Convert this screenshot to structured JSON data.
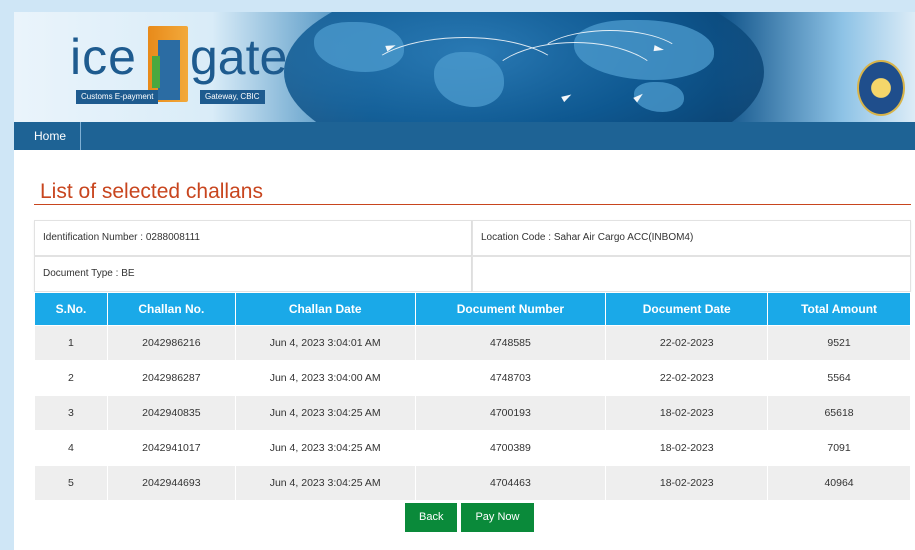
{
  "logo": {
    "ice": "ice",
    "gate": "gate",
    "sub_left": "Customs E-payment",
    "sub_right": "Gateway, CBIC"
  },
  "nav": {
    "home": "Home"
  },
  "page_title": "List of selected challans",
  "info": {
    "identification": "Identification Number : 0288008111",
    "location": "Location Code : Sahar Air Cargo ACC(INBOM4)",
    "document_type": "Document Type : BE",
    "empty": ""
  },
  "table": {
    "headers": [
      "S.No.",
      "Challan No.",
      "Challan Date",
      "Document Number",
      "Document Date",
      "Total Amount"
    ],
    "rows": [
      [
        "1",
        "2042986216",
        "Jun 4, 2023 3:04:01 AM",
        "4748585",
        "22-02-2023",
        "9521"
      ],
      [
        "2",
        "2042986287",
        "Jun 4, 2023 3:04:00 AM",
        "4748703",
        "22-02-2023",
        "5564"
      ],
      [
        "3",
        "2042940835",
        "Jun 4, 2023 3:04:25 AM",
        "4700193",
        "18-02-2023",
        "65618"
      ],
      [
        "4",
        "2042941017",
        "Jun 4, 2023 3:04:25 AM",
        "4700389",
        "18-02-2023",
        "7091"
      ],
      [
        "5",
        "2042944693",
        "Jun 4, 2023 3:04:25 AM",
        "4704463",
        "18-02-2023",
        "40964"
      ]
    ]
  },
  "buttons": {
    "back": "Back",
    "pay_now": "Pay Now"
  },
  "colors": {
    "accent_title": "#c8451e",
    "table_header": "#1aa9e8",
    "nav_bar": "#1e6395",
    "button_green": "#0a8a3a"
  },
  "icons": {
    "emblem": "emblem-icon",
    "planes": "plane-icon"
  }
}
